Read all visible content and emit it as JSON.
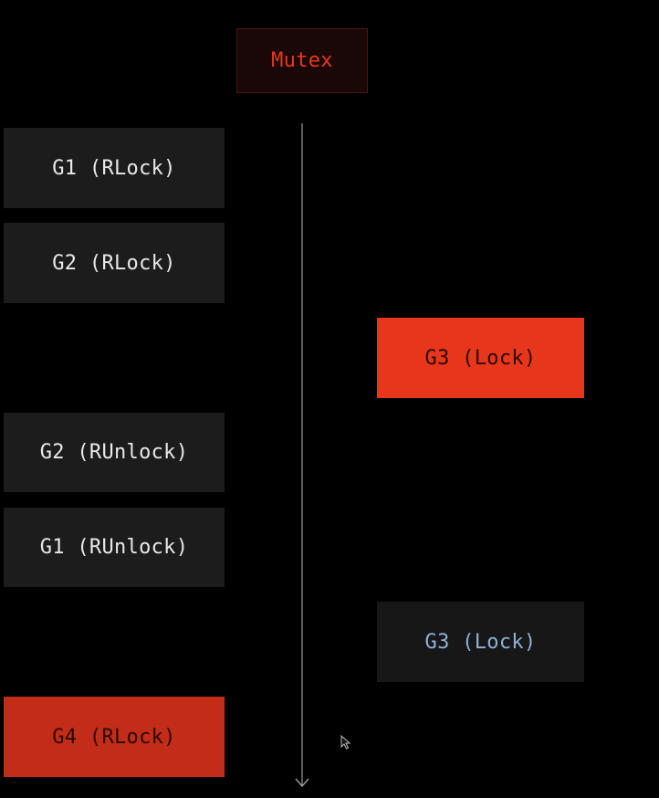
{
  "mutex": {
    "label": "Mutex"
  },
  "events": [
    {
      "label": "G1 (RLock)",
      "column": "left",
      "style": "dark"
    },
    {
      "label": "G2 (RLock)",
      "column": "left",
      "style": "dark"
    },
    {
      "label": "G3 (Lock)",
      "column": "right",
      "style": "red"
    },
    {
      "label": "G2 (RUnlock)",
      "column": "left",
      "style": "dark"
    },
    {
      "label": "G1 (RUnlock)",
      "column": "left",
      "style": "dark"
    },
    {
      "label": "G3 (Lock)",
      "column": "right",
      "style": "blue-text"
    },
    {
      "label": "G4 (RLock)",
      "column": "left",
      "style": "red"
    }
  ],
  "colors": {
    "background": "#000000",
    "accent_red": "#e8361c",
    "box_dark": "#1c1c1c",
    "text_light": "#e8e8e8",
    "text_blue": "#8fb0d8",
    "timeline": "#9a9a9a"
  }
}
